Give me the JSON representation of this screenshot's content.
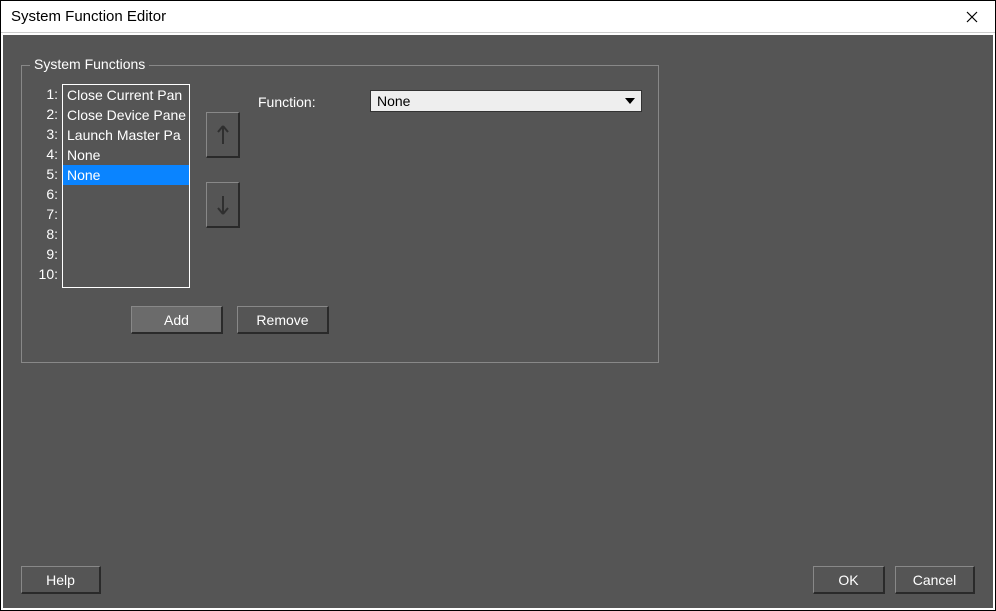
{
  "window": {
    "title": "System Function Editor"
  },
  "groupbox": {
    "legend": "System Functions"
  },
  "list": {
    "numbers": [
      "1:",
      "2:",
      "3:",
      "4:",
      "5:",
      "6:",
      "7:",
      "8:",
      "9:",
      "10:"
    ],
    "items": [
      {
        "label": "Close Current Pan",
        "selected": false
      },
      {
        "label": "Close Device Pane",
        "selected": false
      },
      {
        "label": "Launch Master Pa",
        "selected": false
      },
      {
        "label": "None",
        "selected": false
      },
      {
        "label": "None",
        "selected": true
      }
    ]
  },
  "function": {
    "label": "Function:",
    "selected": "None"
  },
  "buttons": {
    "add": "Add",
    "remove": "Remove",
    "help": "Help",
    "ok": "OK",
    "cancel": "Cancel"
  }
}
